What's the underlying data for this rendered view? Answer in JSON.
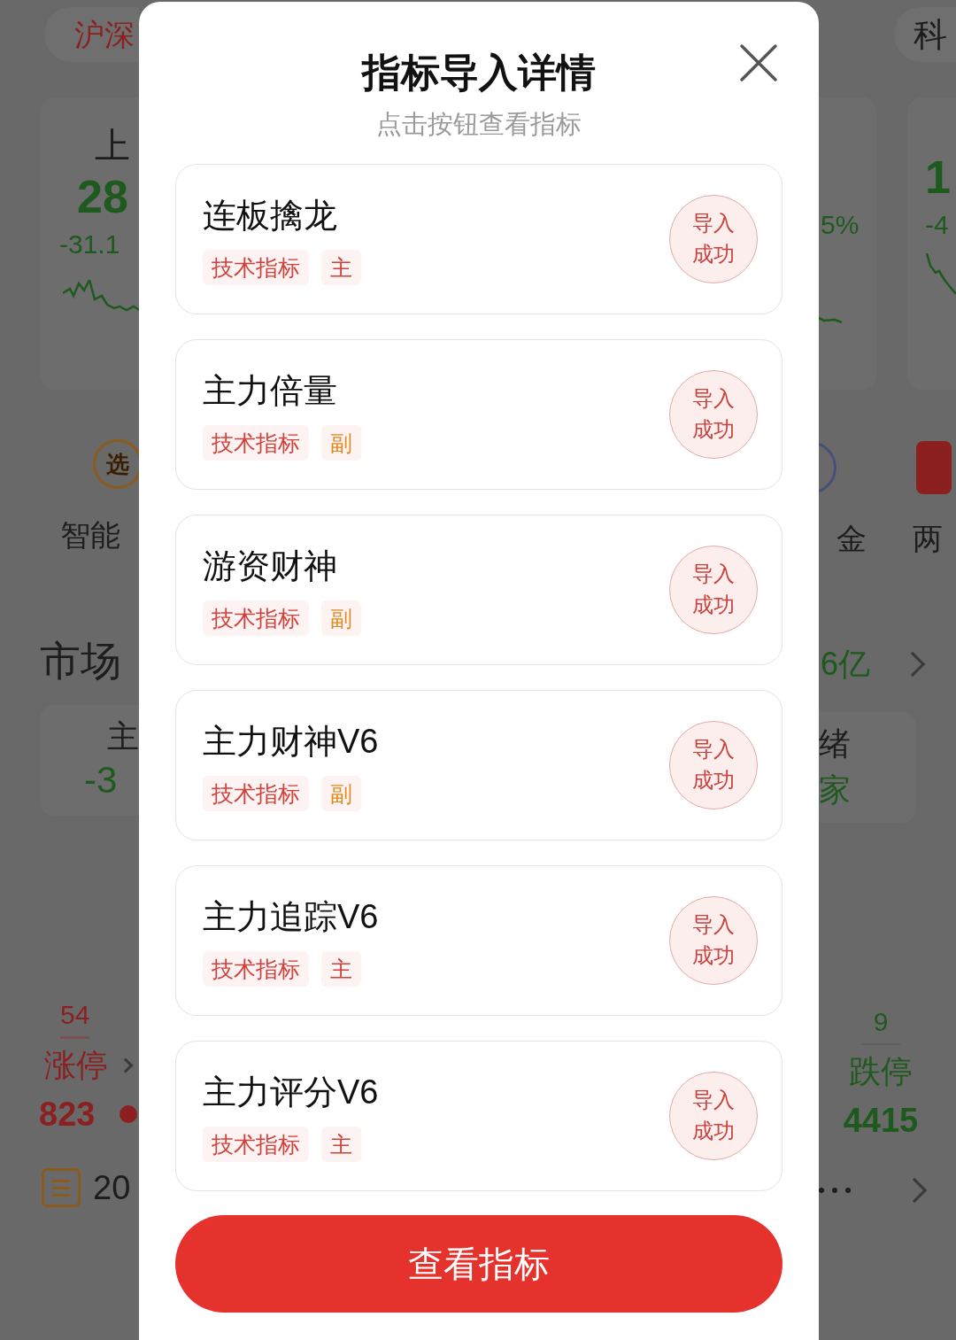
{
  "background": {
    "left": {
      "tab": "沪深",
      "index_card": {
        "name": "上",
        "value": "28",
        "change": "-31.1"
      },
      "shortcut": {
        "icon_text": "选",
        "label": "智能"
      },
      "section_title": "市场",
      "stat": {
        "label": "主",
        "value": "-3"
      },
      "limit_up": {
        "count": "54",
        "label": "涨停",
        "total": "823"
      },
      "news": {
        "date": "20"
      }
    },
    "right": {
      "tab": "科",
      "index_cards": [
        {
          "change": "5%"
        },
        {
          "value": "1",
          "change": "-4"
        }
      ],
      "shortcuts": [
        {
          "label": "金"
        },
        {
          "label": "两"
        }
      ],
      "section_value": "6亿",
      "stat": {
        "label": "绪",
        "value": "家"
      },
      "limit_down": {
        "count": "9",
        "label": "跌停",
        "total": "4415"
      }
    }
  },
  "dialog": {
    "title": "指标导入详情",
    "subtitle": "点击按钮查看指标",
    "items": [
      {
        "name": "连板擒龙",
        "tags": [
          {
            "text": "技术指标",
            "color": "#d0413c"
          },
          {
            "text": "主",
            "color": "#d0413c"
          }
        ],
        "status": "导入成功"
      },
      {
        "name": "主力倍量",
        "tags": [
          {
            "text": "技术指标",
            "color": "#d0413c"
          },
          {
            "text": "副",
            "color": "#e08a1e"
          }
        ],
        "status": "导入成功"
      },
      {
        "name": "游资财神",
        "tags": [
          {
            "text": "技术指标",
            "color": "#d0413c"
          },
          {
            "text": "副",
            "color": "#e08a1e"
          }
        ],
        "status": "导入成功"
      },
      {
        "name": "主力财神V6",
        "tags": [
          {
            "text": "技术指标",
            "color": "#d0413c"
          },
          {
            "text": "副",
            "color": "#e08a1e"
          }
        ],
        "status": "导入成功"
      },
      {
        "name": "主力追踪V6",
        "tags": [
          {
            "text": "技术指标",
            "color": "#d0413c"
          },
          {
            "text": "主",
            "color": "#d0413c"
          }
        ],
        "status": "导入成功"
      },
      {
        "name": "主力评分V6",
        "tags": [
          {
            "text": "技术指标",
            "color": "#d0413c"
          },
          {
            "text": "主",
            "color": "#d0413c"
          }
        ],
        "status": "导入成功"
      }
    ],
    "button": "查看指标"
  }
}
